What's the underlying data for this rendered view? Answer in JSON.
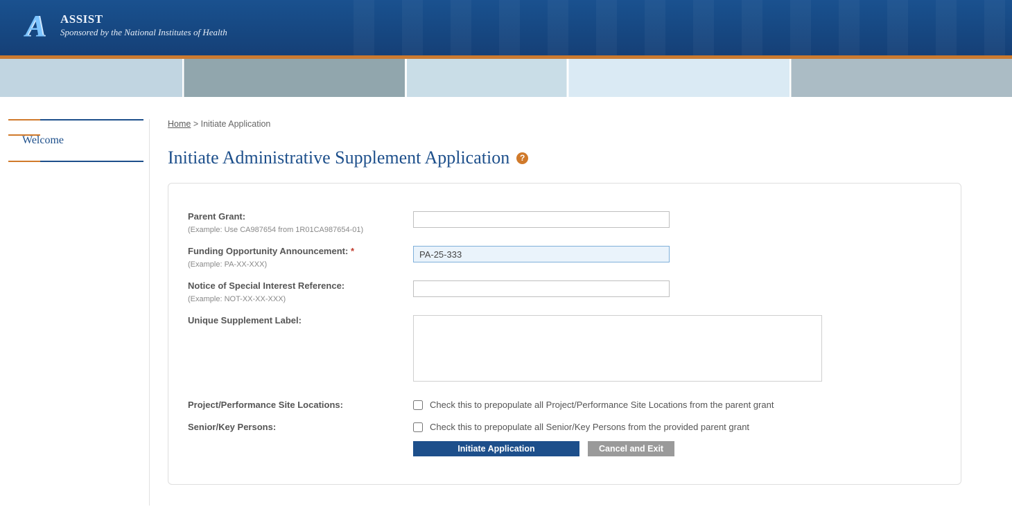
{
  "brand": {
    "title": "ASSIST",
    "subtitle": "Sponsored by the National Institutes of Health"
  },
  "sidebar": {
    "items": [
      {
        "label": "Welcome"
      }
    ]
  },
  "breadcrumb": {
    "home": "Home",
    "sep": ">",
    "current": "Initiate Application"
  },
  "page": {
    "title": "Initiate Administrative Supplement Application"
  },
  "form": {
    "parent_grant": {
      "label": "Parent Grant:",
      "hint": "(Example: Use CA987654 from 1R01CA987654-01)",
      "value": ""
    },
    "foa": {
      "label": "Funding Opportunity Announcement:",
      "required_mark": "*",
      "hint": "(Example: PA-XX-XXX)",
      "value": "PA-25-333"
    },
    "nosi": {
      "label": "Notice of Special Interest Reference:",
      "hint": "(Example: NOT-XX-XX-XXX)",
      "value": ""
    },
    "supp_label": {
      "label": "Unique Supplement Label:",
      "value": ""
    },
    "sites": {
      "label": "Project/Performance Site Locations:",
      "checkbox_text": "Check this to prepopulate all Project/Performance Site Locations from the parent grant",
      "checked": false
    },
    "persons": {
      "label": "Senior/Key Persons:",
      "checkbox_text": "Check this to prepopulate all Senior/Key Persons from the provided parent grant",
      "checked": false
    },
    "actions": {
      "initiate": "Initiate Application",
      "cancel": "Cancel and Exit"
    }
  }
}
